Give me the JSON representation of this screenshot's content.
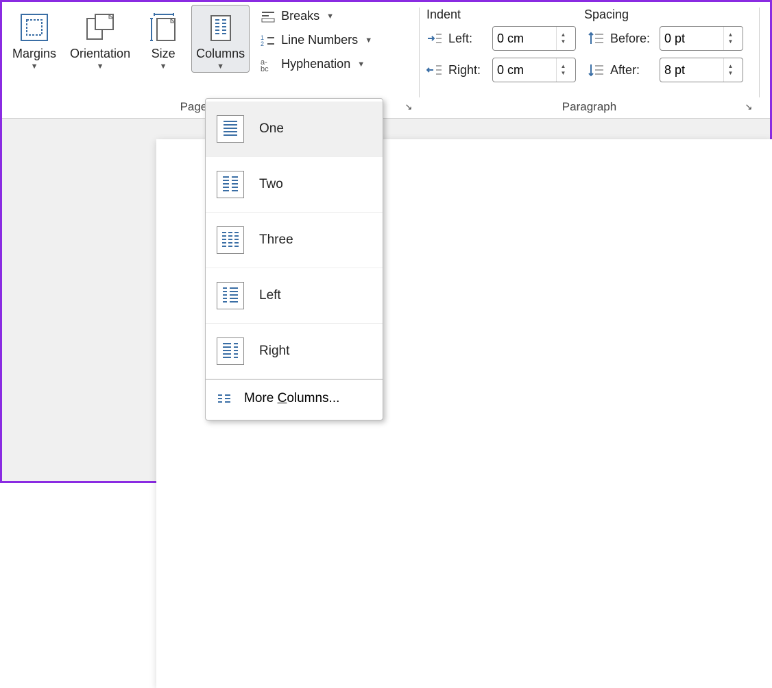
{
  "ribbon": {
    "page_setup": {
      "label": "Page Setup",
      "margins": "Margins",
      "orientation": "Orientation",
      "size": "Size",
      "columns": "Columns",
      "breaks": "Breaks",
      "line_numbers": "Line Numbers",
      "hyphenation": "Hyphenation"
    },
    "paragraph": {
      "label": "Paragraph",
      "indent_header": "Indent",
      "spacing_header": "Spacing",
      "left_label": "Left:",
      "right_label": "Right:",
      "before_label": "Before:",
      "after_label": "After:",
      "left_value": "0 cm",
      "right_value": "0 cm",
      "before_value": "0 pt",
      "after_value": "8 pt"
    }
  },
  "columns_menu": {
    "one": "One",
    "two": "Two",
    "three": "Three",
    "left": "Left",
    "right": "Right",
    "more_pre": "More ",
    "more_letter": "C",
    "more_post": "olumns..."
  }
}
